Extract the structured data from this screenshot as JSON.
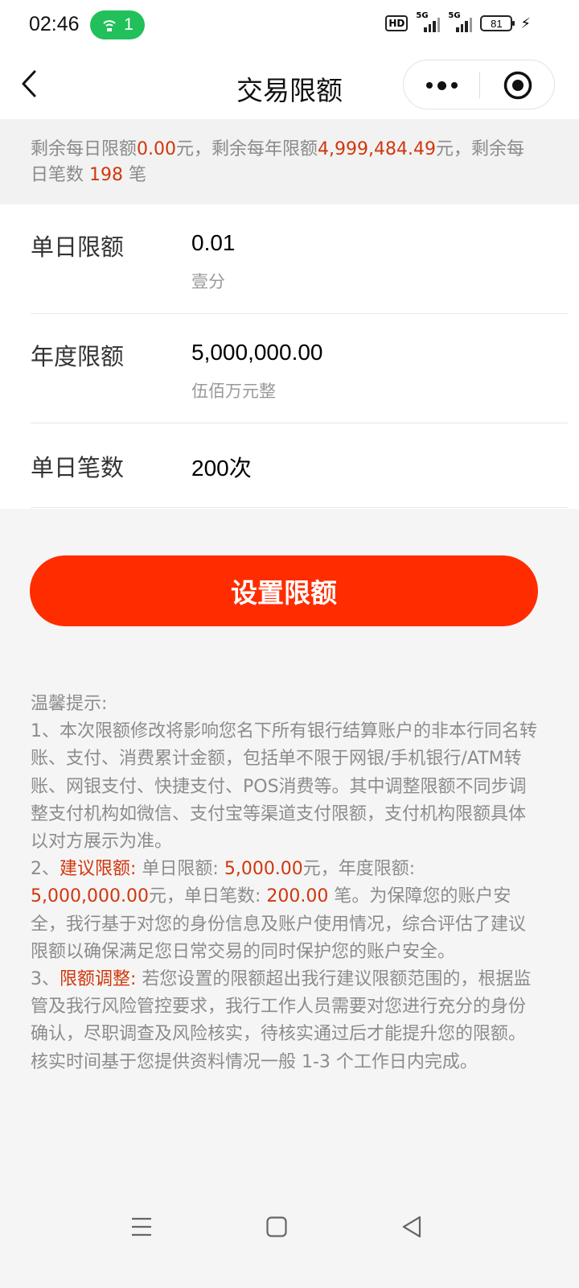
{
  "status_bar": {
    "time": "02:46",
    "hotspot_count": "1",
    "hd_label": "HD",
    "signal1_label": "5G",
    "signal2_label": "5G",
    "battery": "81"
  },
  "nav": {
    "title": "交易限额"
  },
  "summary": {
    "p1": "剩余每日限额",
    "daily_remaining": "0.00",
    "p2": "元，剩余每年限额",
    "yearly_remaining": "4,999,484.49",
    "p3": "元，剩余每",
    "p4": "日笔数 ",
    "count_remaining": "198",
    "p5": " 笔"
  },
  "form": {
    "daily": {
      "label": "单日限额",
      "value": "0.01",
      "sub": "壹分"
    },
    "yearly": {
      "label": "年度限额",
      "value": "5,000,000.00",
      "sub": "伍佰万元整"
    },
    "count": {
      "label": "单日笔数",
      "value": "200次"
    }
  },
  "button": {
    "label": "设置限额"
  },
  "tips": {
    "heading": "温馨提示:",
    "item1": "1、本次限额修改将影响您名下所有银行结算账户的非本行同名转账、支付、消费累计金额，包括单不限于网银/手机银行/ATM转账、网银支付、快捷支付、POS消费等。其中调整限额不同步调整支付机构如微信、支付宝等渠道支付限额，支付机构限额具体以对方展示为准。",
    "item2_prefix": "2、",
    "item2_key": "建议限额:",
    "item2_a": " 单日限额: ",
    "item2_daily": "5,000.00",
    "item2_b": "元，年度限额: ",
    "item2_yearly": "5,000,000.00",
    "item2_c": "元，单日笔数: ",
    "item2_count": "200.00",
    "item2_d": " 笔。为保障您的账户安全，我行基于对您的身份信息及账户使用情况，综合评估了建议限额以确保满足您日常交易的同时保护您的账户安全。",
    "item3_prefix": "3、",
    "item3_key": "限额调整:",
    "item3_text": " 若您设置的限额超出我行建议限额范围的，根据监管及我行风险管控要求，我行工作人员需要对您进行充分的身份确认，尽职调查及风险核实，待核实通过后才能提升您的限额。核实时间基于您提供资料情况一般 1-3 个工作日内完成。"
  },
  "icons": {
    "back": "chevron-left-icon",
    "more": "more-dots-icon",
    "close": "target-close-icon",
    "menu": "menu-icon",
    "home": "home-square-icon",
    "back_nav": "back-triangle-icon"
  },
  "colors": {
    "accent": "#ff2c00",
    "highlight_text": "#d2360c",
    "hotspot": "#21c05a"
  }
}
